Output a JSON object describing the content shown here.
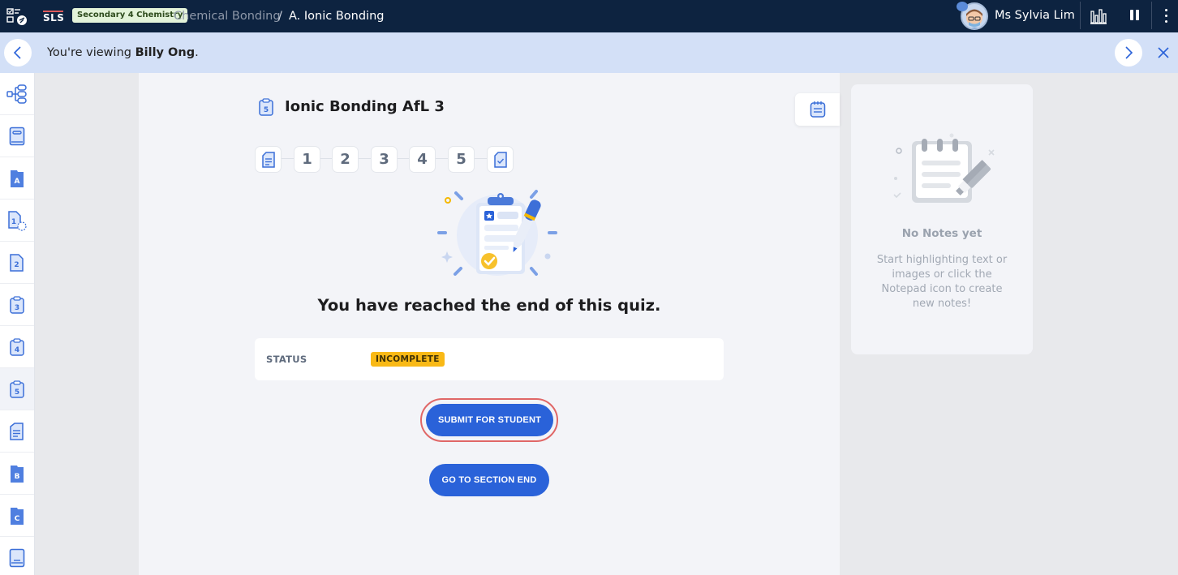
{
  "topbar": {
    "logo": "SLS",
    "subject_badge": "Secondary 4 Chemistry",
    "breadcrumb": [
      "Chemical Bonding",
      "/",
      "A. Ionic Bonding"
    ],
    "user_name": "Ms Sylvia Lim",
    "icons": {
      "tasks": "tasks-icon",
      "stats": "bar-chart-icon",
      "pause": "pause-icon",
      "more": "kebab-menu-icon"
    }
  },
  "viewing_banner": {
    "prefix": "You're viewing ",
    "student": "Billy Ong",
    "suffix": "."
  },
  "sidebar": {
    "items": [
      {
        "icon": "tree-structure-icon",
        "label": ""
      },
      {
        "icon": "book-icon",
        "label": ""
      },
      {
        "icon": "folder-icon",
        "label": "A"
      },
      {
        "icon": "document-icon",
        "label": "1"
      },
      {
        "icon": "document-icon",
        "label": "2"
      },
      {
        "icon": "clipboard-icon",
        "label": "3"
      },
      {
        "icon": "clipboard-icon",
        "label": "4"
      },
      {
        "icon": "clipboard-icon",
        "label": "5",
        "active": true
      },
      {
        "icon": "text-document-icon",
        "label": ""
      },
      {
        "icon": "folder-icon",
        "label": "B"
      },
      {
        "icon": "folder-icon",
        "label": "C"
      },
      {
        "icon": "book-icon",
        "label": ""
      }
    ]
  },
  "quiz": {
    "title_icon_label": "5",
    "title": "Ionic Bonding AfL 3",
    "steps": [
      "1",
      "2",
      "3",
      "4",
      "5"
    ],
    "end_message": "You have reached the end of this quiz.",
    "status_label": "STATUS",
    "status_value": "INCOMPLETE",
    "submit_button": "SUBMIT FOR STUDENT",
    "section_end_button": "GO TO SECTION END"
  },
  "notes": {
    "title": "No Notes yet",
    "description": "Start highlighting text or images or click the Notepad icon to create new notes!"
  },
  "colors": {
    "topbar_bg": "#0d2340",
    "banner_bg": "#d3e0f7",
    "primary": "#2a62d9",
    "status_incomplete": "#f9b916",
    "highlight_ring": "#e06767"
  }
}
